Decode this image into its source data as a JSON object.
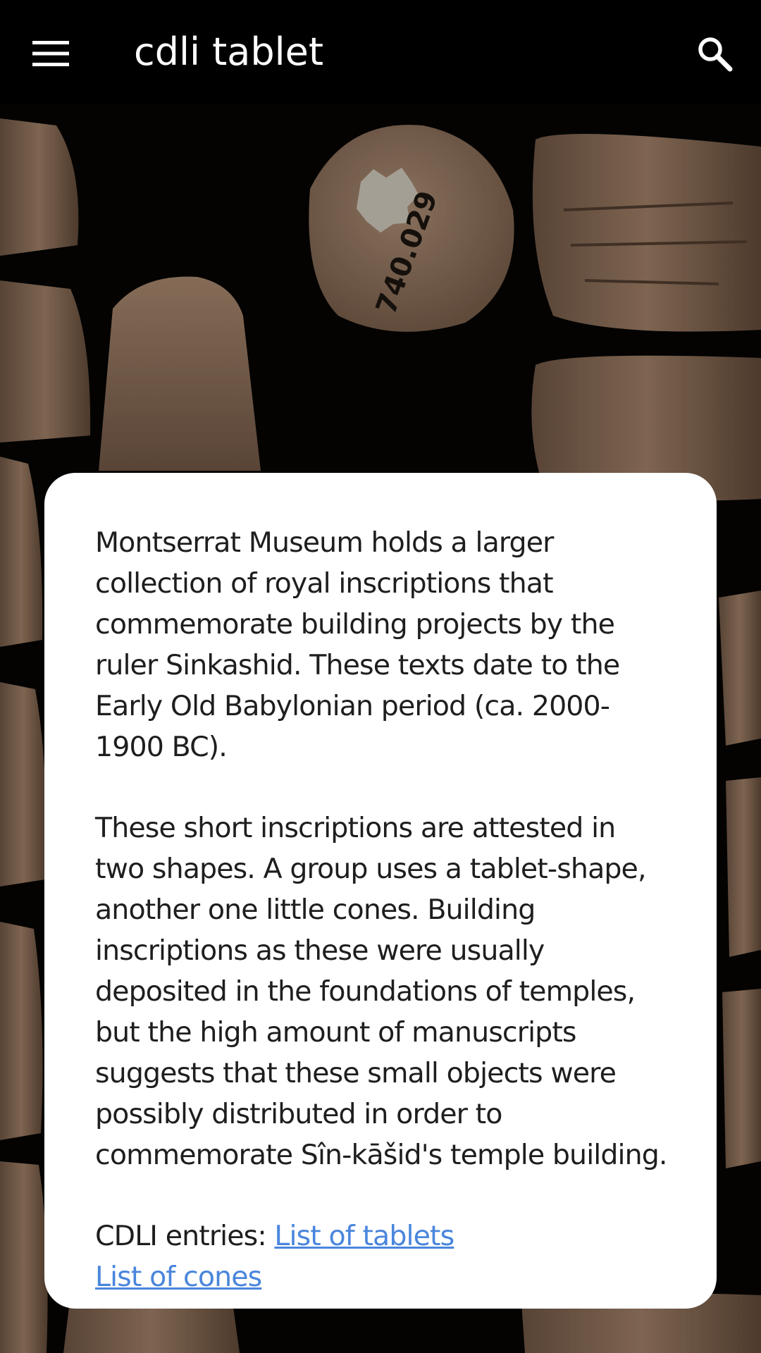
{
  "app_bar": {
    "title": "cdli tablet",
    "menu_icon": "hamburger-menu-icon",
    "search_icon": "search-icon"
  },
  "background": {
    "cone_label": "740.029"
  },
  "card": {
    "paragraph_1": "Montserrat Museum holds a larger collection of royal inscriptions that commemorate building projects by the ruler Sinkashid. These texts date to the Early Old Babylonian period (ca. 2000-1900 BC).",
    "paragraph_2": "These short inscriptions are attested in two shapes. A group uses a tablet-shape, another one little cones. Building inscriptions as these were usually deposited in the foundations of temples, but the high amount of manuscripts suggests that these small objects were possibly distributed in order to commemorate Sîn-kāšid's temple building.",
    "entries_label": "CDLI entries: ",
    "link_tablets": "List of tablets",
    "link_cones": "List of cones"
  },
  "colors": {
    "app_bar": "#000000",
    "card": "#ffffff",
    "text": "#1e1e1e",
    "link": "#4a86dc",
    "clay": "#8e6f58"
  }
}
